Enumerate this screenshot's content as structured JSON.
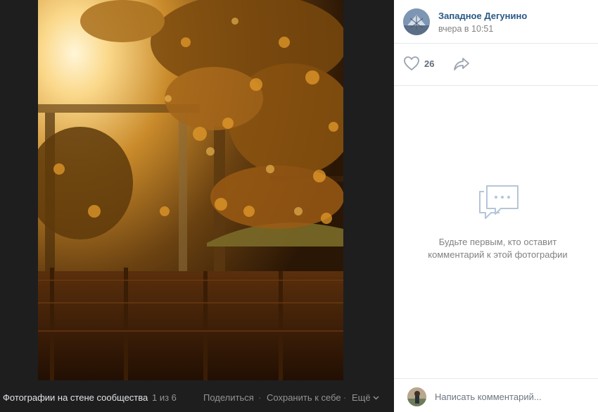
{
  "viewer": {
    "album_title": "Фотографии на стене сообщества",
    "counter": "1 из 6",
    "share_label": "Поделиться",
    "separator": "·",
    "save_label": "Сохранить к себе",
    "more_label": "Ещё"
  },
  "author": {
    "name": "Западное Дегунино",
    "time": "вчера в 10:51"
  },
  "actions": {
    "likes": "26"
  },
  "comments": {
    "empty_line1": "Будьте первым, кто оставит",
    "empty_line2": "комментарий к этой фотографии"
  },
  "composer": {
    "placeholder": "Написать комментарий..."
  },
  "colors": {
    "viewer_bg": "#1e1e1f",
    "link": "#2a5885",
    "muted": "#828282",
    "icon": "#99a2ad"
  }
}
